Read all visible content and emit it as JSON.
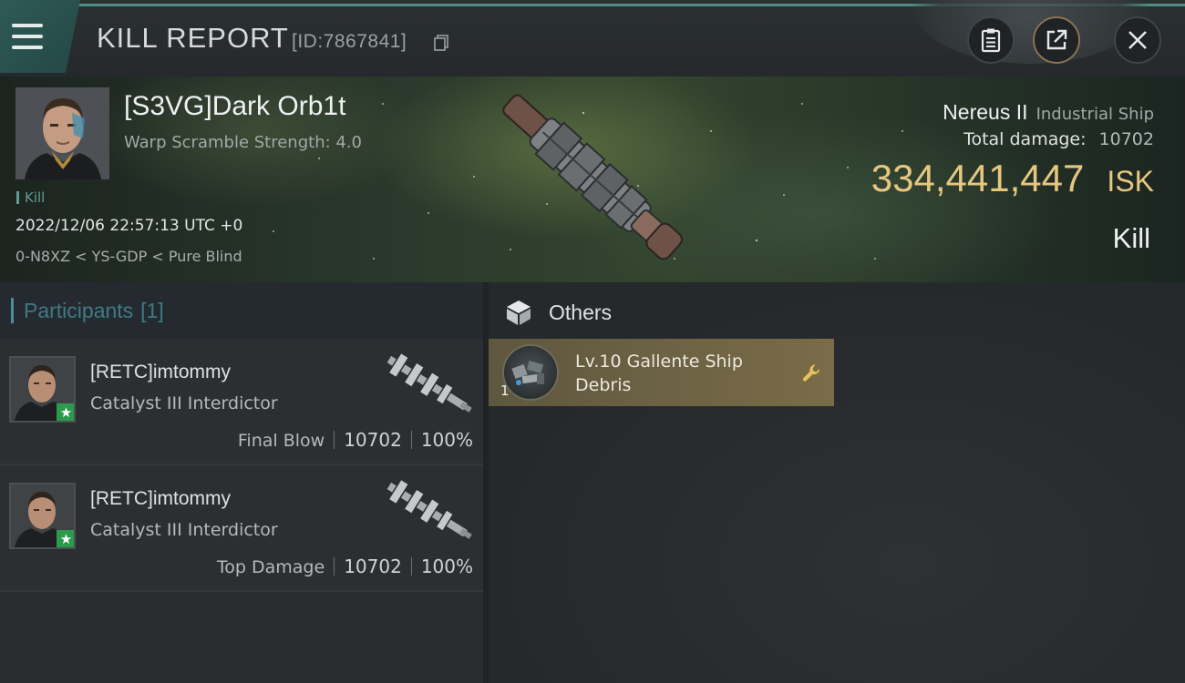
{
  "header": {
    "title": "KILL REPORT",
    "report_id": "[ID:7867841]",
    "icons": {
      "menu": "hamburger-menu-icon",
      "copy": "copy-icon",
      "clipboard": "clipboard-icon",
      "share": "share-icon",
      "close": "close-icon"
    }
  },
  "victim": {
    "pilot_name": "[S3VG]Dark Orb1t",
    "warp_scramble": "Warp Scramble Strength: 4.0",
    "tag": "Kill",
    "time": "2022/12/06 22:57:13 UTC +0",
    "location": "0-N8XZ < YS-GDP < Pure Blind",
    "ship_name": "Nereus II",
    "ship_class": "Industrial Ship",
    "total_damage_label": "Total damage:",
    "total_damage_value": "10702",
    "isk_value": "334,441,447",
    "isk_unit": "ISK",
    "result": "Kill"
  },
  "participants": {
    "header": "Participants",
    "count": "[1]",
    "rows": [
      {
        "name": "[RETC]imtommy",
        "ship": "Catalyst III Interdictor",
        "stat_label": "Final Blow",
        "damage": "10702",
        "percent": "100%"
      },
      {
        "name": "[RETC]imtommy",
        "ship": "Catalyst III Interdictor",
        "stat_label": "Top Damage",
        "damage": "10702",
        "percent": "100%"
      }
    ]
  },
  "others": {
    "title": "Others",
    "items": [
      {
        "quantity": "1",
        "name": "Lv.10 Gallente Ship Debris"
      }
    ]
  },
  "colors": {
    "isk_gold": "#e6c77f",
    "teal_accent": "#4b8e99",
    "loot_highlight": "#7a6c48",
    "corp_badge_green": "#2c9a4c"
  }
}
